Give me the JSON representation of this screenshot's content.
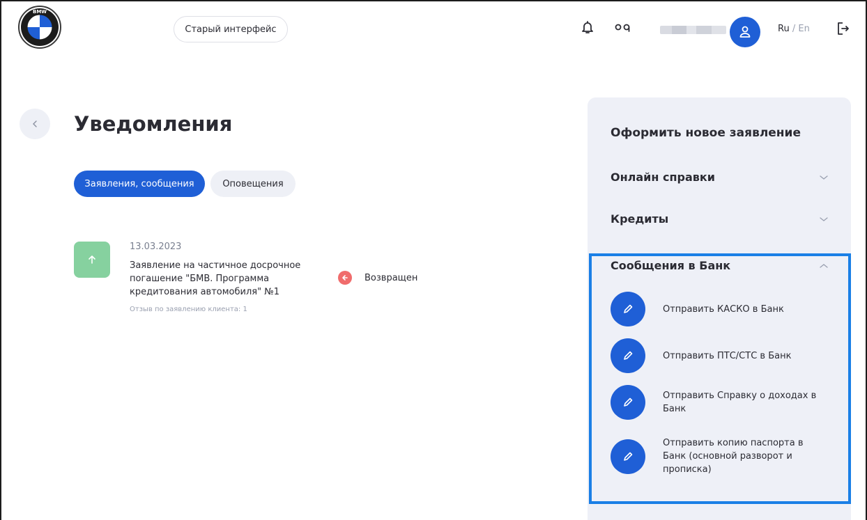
{
  "header": {
    "logo_letters": "BMW",
    "old_interface_label": "Старый интерфейс",
    "lang_ru": "Ru",
    "lang_sep": " / ",
    "lang_en": "En"
  },
  "main": {
    "title": "Уведомления",
    "tabs": [
      {
        "label": "Заявления, сообщения",
        "active": true
      },
      {
        "label": "Оповещения",
        "active": false
      }
    ],
    "notification": {
      "date": "13.03.2023",
      "text": "Заявление на частичное досрочное погашение \"БМВ. Программа кредитования автомобиля\" №1",
      "feedback": "Отзыв по заявлению клиента: 1",
      "status": "Возвращен"
    }
  },
  "panel": {
    "title": "Оформить новое заявление",
    "sections": [
      {
        "label": "Онлайн справки",
        "expanded": false
      },
      {
        "label": "Кредиты",
        "expanded": false
      },
      {
        "label": "Сообщения в Банк",
        "expanded": true
      }
    ],
    "actions": [
      {
        "label": "Отправить КАСКО в Банк"
      },
      {
        "label": "Отправить ПТС/СТС в Банк"
      },
      {
        "label": "Отправить Справку о доходах в Банк"
      },
      {
        "label": "Отправить копию паспорта в Банк (основной разворот и прописка)"
      }
    ]
  },
  "colors": {
    "accent": "#1f5fd6",
    "highlight": "#1a7fe6",
    "success": "#86d19f",
    "danger": "#f06c6c"
  },
  "icons": [
    "bmw-logo",
    "bell-icon",
    "glasses-icon",
    "user-icon",
    "logout-icon",
    "chevron-left-icon",
    "arrow-up-icon",
    "arrow-left-icon",
    "chevron-down-icon",
    "chevron-up-icon",
    "pencil-icon"
  ]
}
